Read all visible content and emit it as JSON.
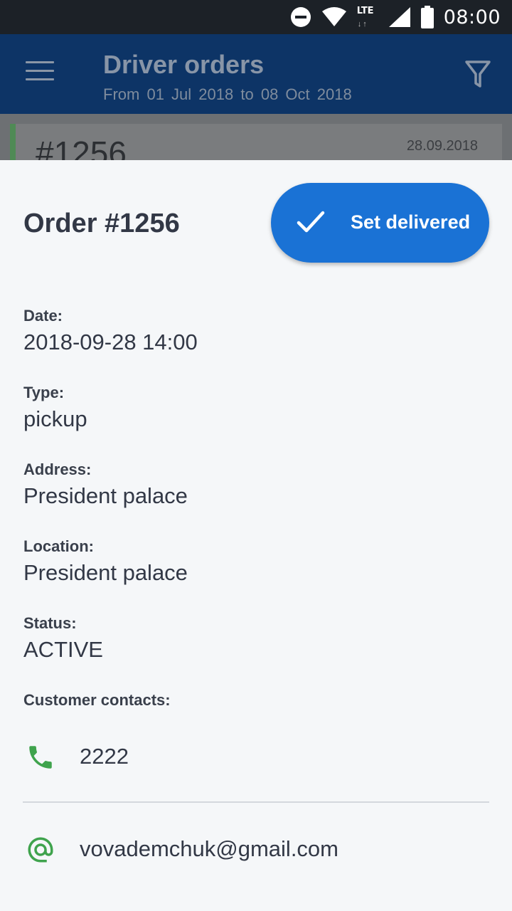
{
  "status_bar": {
    "network": "LTE",
    "time": "08:00"
  },
  "app_bar": {
    "title": "Driver orders",
    "from_label": "From",
    "from_date": "01 Jul 2018",
    "to_label": "to",
    "to_date": "08 Oct 2018"
  },
  "background_card": {
    "number": "#1256",
    "date": "28.09.2018"
  },
  "sheet": {
    "title": "Order #1256",
    "deliver_button": "Set delivered",
    "fields": {
      "date_label": "Date:",
      "date_value": "2018-09-28 14:00",
      "type_label": "Type:",
      "type_value": "pickup",
      "address_label": "Address:",
      "address_value": "President palace",
      "location_label": "Location:",
      "location_value": "President palace",
      "status_label": "Status:",
      "status_value": "ACTIVE",
      "contacts_label": "Customer contacts:"
    },
    "contacts": {
      "phone": "2222",
      "email": "vovademchuk@gmail.com"
    }
  },
  "colors": {
    "primary": "#1a72d5",
    "contact_icon": "#3fa34d",
    "text": "#323846"
  },
  "icons": {
    "phone": "phone-icon",
    "email": "at-sign-icon",
    "check": "check-icon",
    "filter": "filter-icon",
    "menu": "hamburger-menu-icon"
  }
}
